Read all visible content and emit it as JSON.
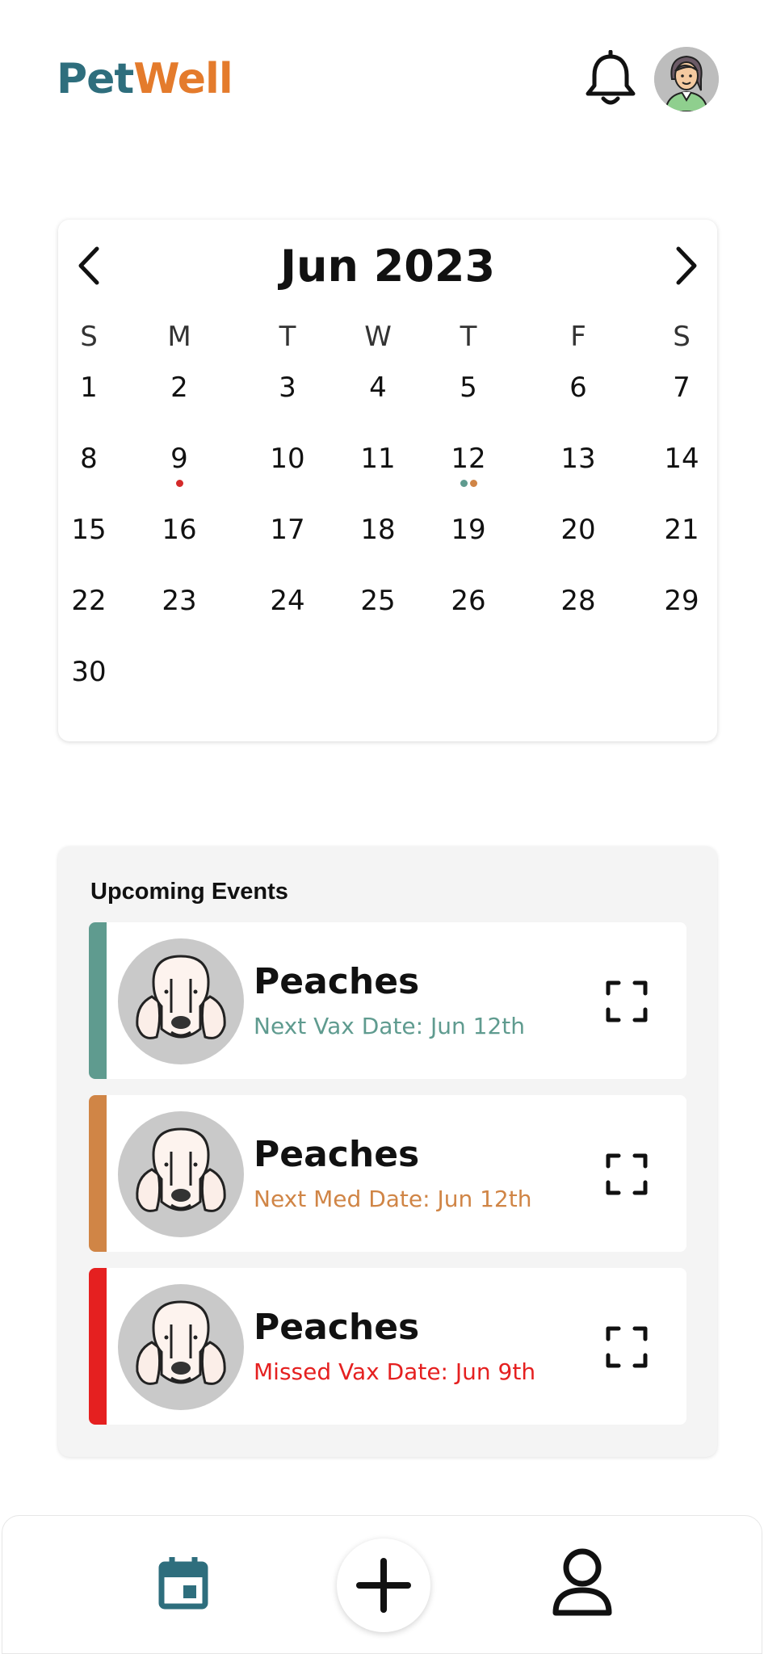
{
  "header": {
    "logo_part1": "Pet",
    "logo_part2": "Well",
    "colors": {
      "logo_teal": "#2e6e7d",
      "logo_orange": "#e47b2c"
    }
  },
  "calendar": {
    "title": "Jun 2023",
    "weekdays": [
      "S",
      "M",
      "T",
      "W",
      "T",
      "F",
      "S"
    ],
    "days": [
      [
        "1",
        "2",
        "3",
        "4",
        "5",
        "6",
        "7"
      ],
      [
        "8",
        "9",
        "10",
        "11",
        "12",
        "13",
        "14"
      ],
      [
        "15",
        "16",
        "17",
        "18",
        "19",
        "20",
        "21"
      ],
      [
        "22",
        "23",
        "24",
        "25",
        "26",
        "28",
        "29"
      ],
      [
        "30",
        "",
        "",
        "",
        "",
        "",
        ""
      ]
    ],
    "markers": [
      {
        "day": "9",
        "dots": [
          "#d42a2a"
        ]
      },
      {
        "day": "12",
        "dots": [
          "#5f9b8f",
          "#d08546"
        ]
      }
    ]
  },
  "events": {
    "title": "Upcoming Events",
    "items": [
      {
        "pet_name": "Peaches",
        "label": "Next Vax Date: Jun 12th",
        "color": "#5f9b8f"
      },
      {
        "pet_name": "Peaches",
        "label": "Next Med Date: Jun 12th",
        "color": "#d08546"
      },
      {
        "pet_name": "Peaches",
        "label": "Missed Vax Date: Jun 9th",
        "color": "#e52020"
      }
    ]
  },
  "bottom_nav": {
    "icons": [
      "calendar-icon",
      "add-icon",
      "profile-icon"
    ],
    "active_color": "#2e6e7d"
  }
}
